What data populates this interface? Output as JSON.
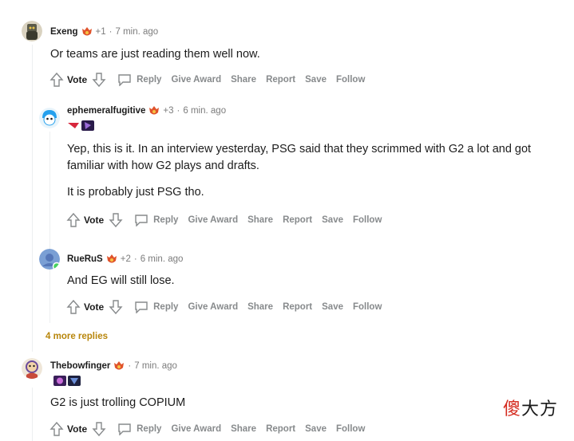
{
  "comments": [
    {
      "username": "Exeng",
      "karma": "+1",
      "dot": "·",
      "time": "7 min. ago",
      "body": [
        "Or teams are just reading them well now."
      ]
    },
    {
      "username": "ephemeralfugitive",
      "karma": "+3",
      "dot": "·",
      "time": "6 min. ago",
      "body": [
        "Yep, this is it. In an interview yesterday, PSG said that they scrimmed with G2 a lot and got",
        "familiar with how G2 plays and drafts.",
        "It is probably just PSG tho."
      ]
    },
    {
      "username": "RueRuS",
      "karma": "+2",
      "dot": "·",
      "time": "6 min. ago",
      "body": [
        "And EG will still lose."
      ]
    },
    {
      "username": "Thebowfinger",
      "karma": "",
      "dot": "·",
      "time": "7 min. ago",
      "body": [
        "G2 is just trolling COPIUM"
      ]
    }
  ],
  "actions": {
    "vote": "Vote",
    "reply": "Reply",
    "give_award": "Give Award",
    "share": "Share",
    "report": "Report",
    "save": "Save",
    "follow": "Follow"
  },
  "more_replies": "4 more replies",
  "watermark": {
    "first": "傻",
    "rest": "大方"
  },
  "icons": [
    "upvote-arrow-icon",
    "downvote-arrow-icon",
    "reply-bubble-icon",
    "flair-fire-icon"
  ],
  "colors": {
    "action_gray": "#878a8c",
    "more_replies": "#b8860b",
    "thread_line": "#edeff1",
    "watermark_red": "#d42a1e"
  }
}
